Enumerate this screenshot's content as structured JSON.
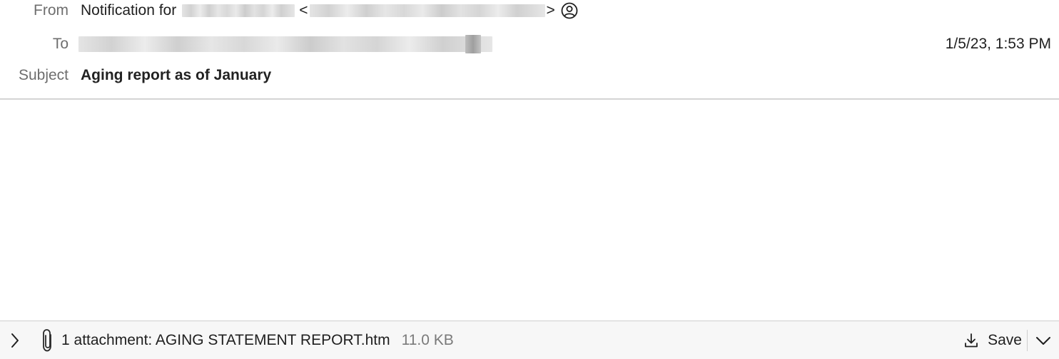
{
  "header": {
    "from": {
      "label": "From",
      "prefix": "Notification for",
      "open_angle": "<",
      "close_angle": ">",
      "icon": "contact-card-icon"
    },
    "to": {
      "label": "To"
    },
    "subject": {
      "label": "Subject",
      "value": "Aging report as of January"
    },
    "date": "1/5/23, 1:53 PM"
  },
  "attachment_bar": {
    "expand_icon": "chevron-right-icon",
    "clip_icon": "paperclip-icon",
    "summary": "1 attachment:  AGING STATEMENT REPORT.htm",
    "size": "11.0 KB",
    "save_label": "Save",
    "save_icon": "download-icon",
    "menu_icon": "chevron-down-icon"
  },
  "colors": {
    "label": "#6e6e6e",
    "text": "#1f1f1f",
    "divider": "#d4d4d4",
    "bar_background": "#f7f7f7"
  }
}
